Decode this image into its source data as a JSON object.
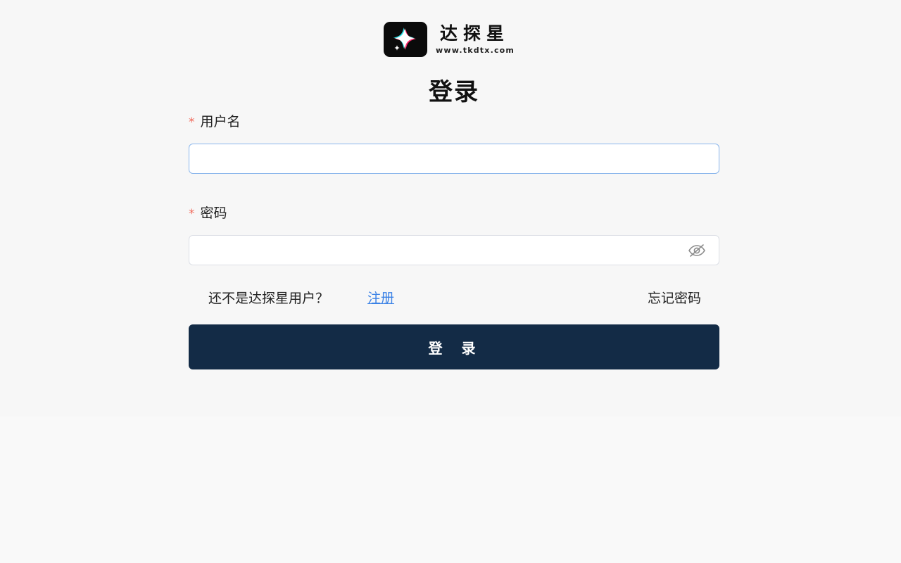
{
  "brand": {
    "name": "达探星",
    "url": "www.tkdtx.com",
    "logo_icon": "sparkle-star-icon",
    "colors": {
      "logo_bg": "#0b0b0b",
      "star_cyan": "#34e0e8",
      "star_pink": "#ff2d6f"
    }
  },
  "page": {
    "title": "登录"
  },
  "form": {
    "required_mark": "*",
    "username": {
      "label": "用户名",
      "value": "",
      "placeholder": ""
    },
    "password": {
      "label": "密码",
      "value": "",
      "placeholder": "",
      "toggle_icon": "eye-off-icon"
    },
    "register_prompt": "还不是达探星用户？",
    "register_link": "注册",
    "forgot_link": "忘记密码",
    "submit_label": "登 录"
  },
  "colors": {
    "primary_button": "#132b46",
    "link": "#3b82e6",
    "required": "#f06a5b",
    "focus_border": "#8ab6ec"
  }
}
